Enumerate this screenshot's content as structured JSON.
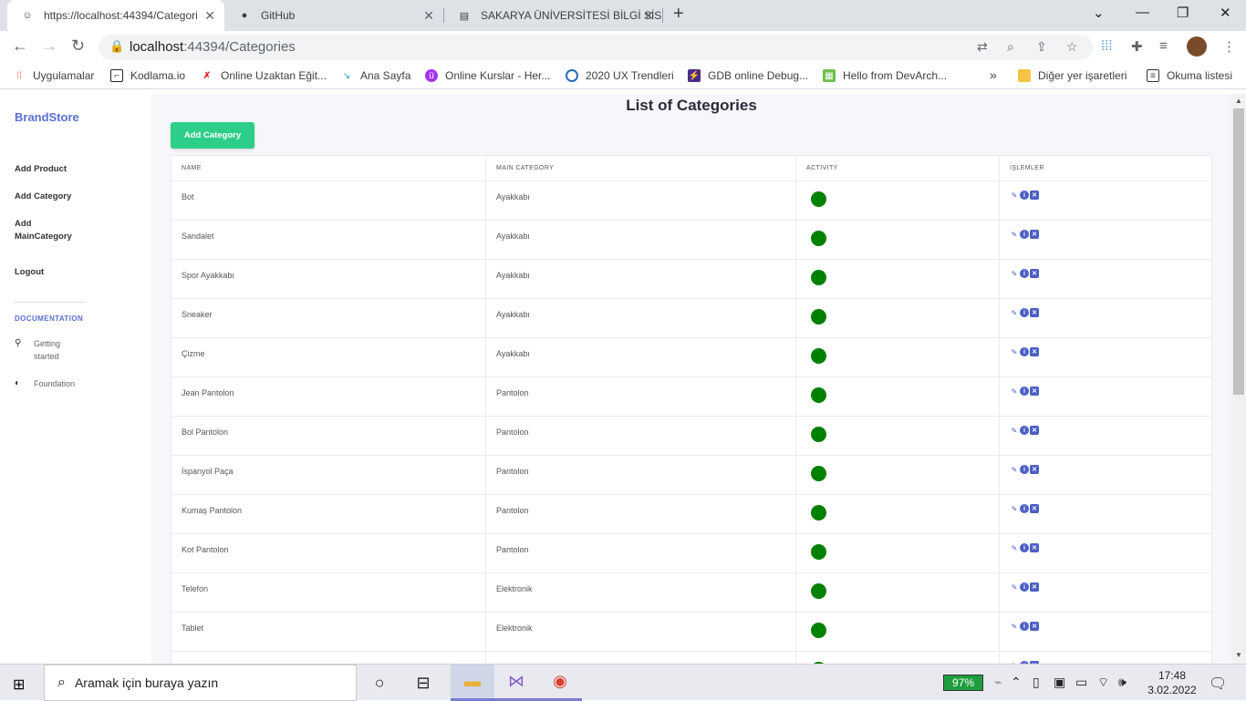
{
  "browser": {
    "tabs": [
      {
        "title": "https://localhost:44394/Categori",
        "active": true
      },
      {
        "title": "GitHub",
        "active": false
      },
      {
        "title": "SAKARYA ÜNİVERSİTESİ BİLGİ SİS",
        "active": false
      }
    ],
    "url_host": "localhost",
    "url_path": ":44394/Categories",
    "bookmarks": [
      {
        "label": "Uygulamalar",
        "icon": "apps-grid-icon"
      },
      {
        "label": "Kodlama.io",
        "icon": "kodlama-icon"
      },
      {
        "label": "Online Uzaktan Eğit...",
        "icon": "x-logo-icon"
      },
      {
        "label": "Ana Sayfa",
        "icon": "pin-icon"
      },
      {
        "label": "Online Kurslar - Her...",
        "icon": "udemy-icon"
      },
      {
        "label": "2020 UX Trendleri",
        "icon": "circle-icon"
      },
      {
        "label": "GDB online Debug...",
        "icon": "bolt-icon"
      },
      {
        "label": "Hello from DevArch...",
        "icon": "devarch-icon"
      }
    ],
    "bookmarks_more": "»",
    "other_bookmarks": "Diğer yer işaretleri",
    "reading_list": "Okuma listesi"
  },
  "sidebar": {
    "brand": "BrandStore",
    "nav": [
      {
        "label": "Add Product"
      },
      {
        "label": "Add Category"
      },
      {
        "label": "Add"
      },
      {
        "label": "MainCategory"
      },
      {
        "label": "Logout"
      }
    ],
    "doc_heading": "DOCUMENTATION",
    "doc_items": [
      {
        "label1": "Getting",
        "label2": "started",
        "icon": "rocket-icon"
      },
      {
        "label1": "Foundation",
        "label2": "",
        "icon": "palette-icon"
      }
    ]
  },
  "main": {
    "title": "List of Categories",
    "add_button": "Add Category",
    "table": {
      "headers": [
        "NAME",
        "MAIN CATEGORY",
        "ACTIVITY",
        "İŞLEMLER"
      ],
      "active_color": "#008000",
      "rows": [
        {
          "name": "Bot",
          "main": "Ayakkabı",
          "active": true
        },
        {
          "name": "Sandalet",
          "main": "Ayakkabı",
          "active": true
        },
        {
          "name": "Spor Ayakkabı",
          "main": "Ayakkabı",
          "active": true
        },
        {
          "name": "Sneaker",
          "main": "Ayakkabı",
          "active": true
        },
        {
          "name": "Çizme",
          "main": "Ayakkabı",
          "active": true
        },
        {
          "name": "Jean Pantolon",
          "main": "Pantolon",
          "active": true
        },
        {
          "name": "Bol Pantolon",
          "main": "Pantolon",
          "active": true
        },
        {
          "name": "İspanyol Paça",
          "main": "Pantolon",
          "active": true
        },
        {
          "name": "Kumaş Pantolon",
          "main": "Pantolon",
          "active": true
        },
        {
          "name": "Kot Pantolon",
          "main": "Pantolon",
          "active": true
        },
        {
          "name": "Telefon",
          "main": "Elektronik",
          "active": true
        },
        {
          "name": "Tablet",
          "main": "Elektronik",
          "active": true
        },
        {
          "name": "",
          "main": "",
          "active": true
        }
      ]
    }
  },
  "taskbar": {
    "search_placeholder": "Aramak için buraya yazın",
    "battery": "97%",
    "time": "17:48",
    "date": "3.02.2022"
  }
}
